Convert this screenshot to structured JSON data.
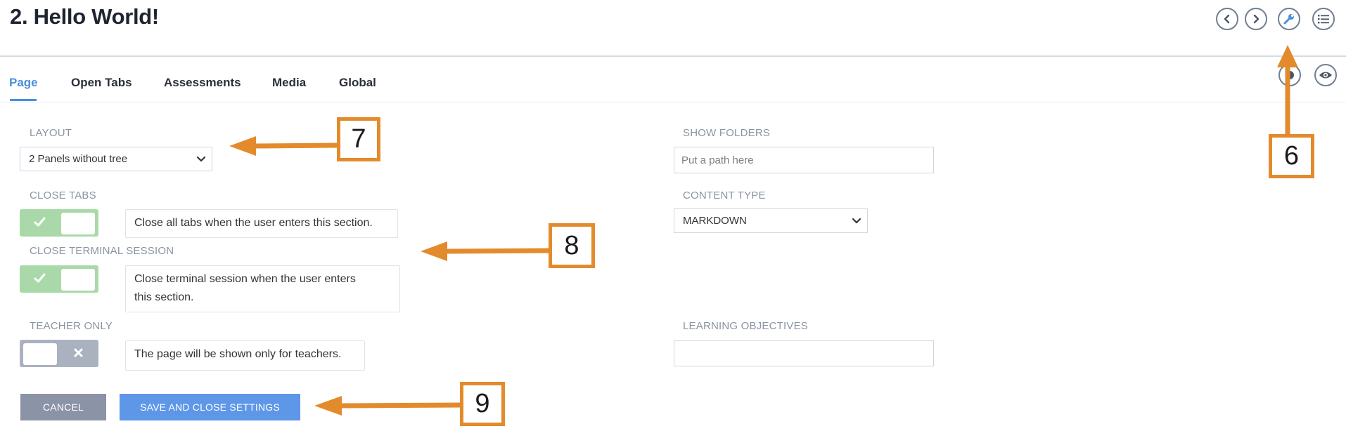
{
  "page": {
    "title": "2. Hello World!"
  },
  "header_buttons": [
    "chevron-left-icon",
    "chevron-right-icon",
    "wrench-icon",
    "list-icon"
  ],
  "tabs": [
    {
      "label": "Page",
      "active": true
    },
    {
      "label": "Open Tabs",
      "active": false
    },
    {
      "label": "Assessments",
      "active": false
    },
    {
      "label": "Media",
      "active": false
    },
    {
      "label": "Global",
      "active": false
    }
  ],
  "form": {
    "layout": {
      "label": "LAYOUT",
      "value": "2 Panels without tree"
    },
    "close_tabs": {
      "label": "CLOSE TABS",
      "enabled": true,
      "help": "Close all tabs when the user enters this section."
    },
    "close_terminal": {
      "label": "CLOSE TERMINAL SESSION",
      "enabled": true,
      "help_line1": "Close terminal session when the user enters",
      "help_line2": "this section."
    },
    "teacher_only": {
      "label": "TEACHER ONLY",
      "enabled": false,
      "help": "The page will be shown only for teachers."
    },
    "show_folders": {
      "label": "SHOW FOLDERS",
      "value": "",
      "placeholder": "Put a path here"
    },
    "content_type": {
      "label": "CONTENT TYPE",
      "value": "MARKDOWN"
    },
    "learning_objectives": {
      "label": "LEARNING OBJECTIVES",
      "value": ""
    }
  },
  "actions": {
    "cancel": "CANCEL",
    "save_close": "SAVE AND CLOSE SETTINGS"
  },
  "callouts": [
    {
      "number": "6"
    },
    {
      "number": "7"
    },
    {
      "number": "8"
    },
    {
      "number": "9"
    }
  ],
  "colors": {
    "accent": "#4a90d9",
    "callout": "#e38b2c",
    "toggle_on": "#a9d9a8",
    "toggle_off": "#aab2bf",
    "cancel": "#8b93a7",
    "save": "#5e97e8"
  }
}
